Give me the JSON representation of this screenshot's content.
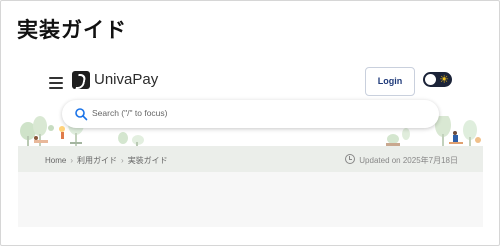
{
  "page": {
    "heading": "実装ガイド"
  },
  "header": {
    "menu_icon": "hamburger-icon",
    "logo_text": "UnivaPay",
    "login_label": "Login",
    "theme_toggle_icon": "sun-icon"
  },
  "search": {
    "placeholder": "Search (\"/\" to focus)",
    "icon": "search-icon"
  },
  "breadcrumb": {
    "items": [
      "Home",
      "利用ガイド",
      "実装ガイド"
    ],
    "separator": "›"
  },
  "updated": {
    "text": "Updated on 2025年7月18日",
    "icon": "clock-icon"
  },
  "colors": {
    "accent": "#1f3a7a",
    "search_icon": "#1a73e8",
    "crumb_bar": "#ebeeea",
    "toggle": "#1b2338"
  }
}
